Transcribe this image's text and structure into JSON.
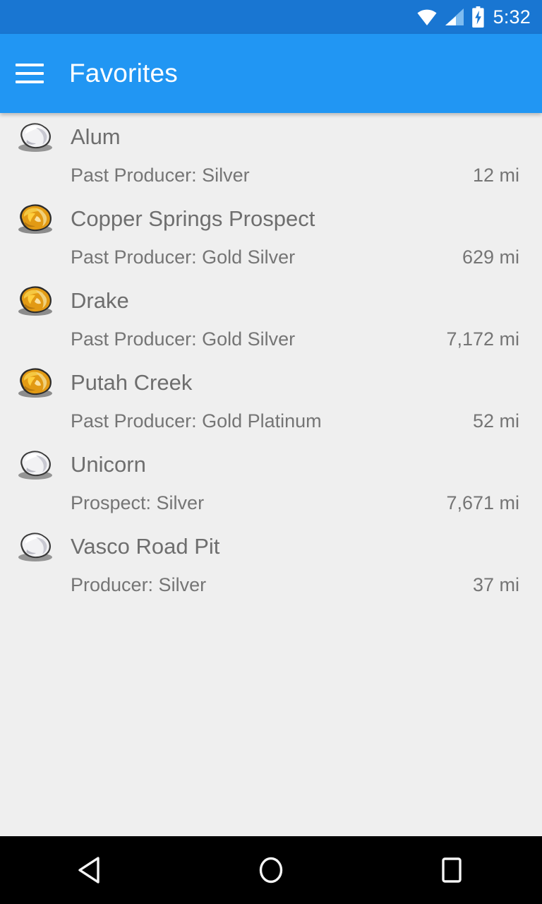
{
  "status_bar": {
    "background_color": "#1976D2",
    "clock": "5:32",
    "icons": [
      "wifi-icon",
      "cellular-signal-icon",
      "battery-charging-icon"
    ]
  },
  "app_bar": {
    "background_color": "#2196F3",
    "title": "Favorites",
    "menu_icon": "hamburger-menu-icon"
  },
  "colors": {
    "background": "#EFEFEF",
    "title_text": "#6E6E6E",
    "subtitle_text": "#757575",
    "accent": "#2196F3",
    "status_bar": "#1976D2",
    "gold_ore": "#E8A317",
    "silver_ore": "#D8D8DC"
  },
  "list": {
    "items": [
      {
        "icon": "silver-ore-icon",
        "ore_type": "silver",
        "title": "Alum",
        "subtitle": "Past Producer: Silver",
        "distance": "12 mi"
      },
      {
        "icon": "gold-ore-icon",
        "ore_type": "gold",
        "title": "Copper Springs Prospect",
        "subtitle": "Past Producer: Gold Silver",
        "distance": "629 mi"
      },
      {
        "icon": "gold-ore-icon",
        "ore_type": "gold",
        "title": "Drake",
        "subtitle": "Past Producer: Gold Silver",
        "distance": "7,172 mi"
      },
      {
        "icon": "gold-ore-icon",
        "ore_type": "gold",
        "title": "Putah Creek",
        "subtitle": "Past Producer: Gold Platinum",
        "distance": "52 mi"
      },
      {
        "icon": "silver-ore-icon",
        "ore_type": "silver",
        "title": "Unicorn",
        "subtitle": "Prospect: Silver",
        "distance": "7,671 mi"
      },
      {
        "icon": "silver-ore-icon",
        "ore_type": "silver",
        "title": "Vasco Road Pit",
        "subtitle": "Producer: Silver",
        "distance": "37 mi"
      }
    ]
  },
  "nav_bar": {
    "background_color": "#000000",
    "buttons": [
      {
        "name": "back-button",
        "icon": "back-triangle-icon"
      },
      {
        "name": "home-button",
        "icon": "home-circle-icon"
      },
      {
        "name": "recents-button",
        "icon": "recents-square-icon"
      }
    ]
  }
}
